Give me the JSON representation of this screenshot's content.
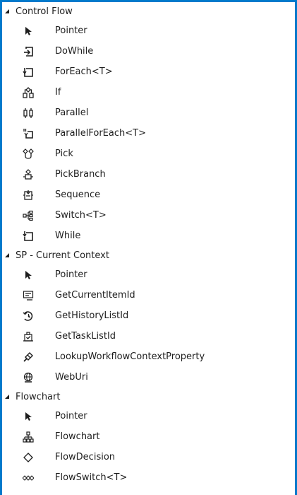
{
  "categories": [
    {
      "label": "Control Flow",
      "items": [
        {
          "label": "Pointer",
          "icon": "pointer-icon"
        },
        {
          "label": "DoWhile",
          "icon": "dowhile-icon"
        },
        {
          "label": "ForEach<T>",
          "icon": "foreach-icon"
        },
        {
          "label": "If",
          "icon": "if-icon"
        },
        {
          "label": "Parallel",
          "icon": "parallel-icon"
        },
        {
          "label": "ParallelForEach<T>",
          "icon": "parallelforeach-icon"
        },
        {
          "label": "Pick",
          "icon": "pick-icon"
        },
        {
          "label": "PickBranch",
          "icon": "pickbranch-icon"
        },
        {
          "label": "Sequence",
          "icon": "sequence-icon"
        },
        {
          "label": "Switch<T>",
          "icon": "switch-icon"
        },
        {
          "label": "While",
          "icon": "while-icon"
        }
      ]
    },
    {
      "label": "SP - Current Context",
      "items": [
        {
          "label": "Pointer",
          "icon": "pointer-icon"
        },
        {
          "label": "GetCurrentItemId",
          "icon": "get-current-item-icon"
        },
        {
          "label": "GetHistoryListId",
          "icon": "history-icon"
        },
        {
          "label": "GetTaskListId",
          "icon": "task-list-icon"
        },
        {
          "label": "LookupWorkflowContextProperty",
          "icon": "lookup-icon"
        },
        {
          "label": "WebUri",
          "icon": "web-icon"
        }
      ]
    },
    {
      "label": "Flowchart",
      "items": [
        {
          "label": "Pointer",
          "icon": "pointer-icon"
        },
        {
          "label": "Flowchart",
          "icon": "flowchart-icon"
        },
        {
          "label": "FlowDecision",
          "icon": "diamond-icon"
        },
        {
          "label": "FlowSwitch<T>",
          "icon": "flowswitch-icon"
        }
      ]
    }
  ]
}
